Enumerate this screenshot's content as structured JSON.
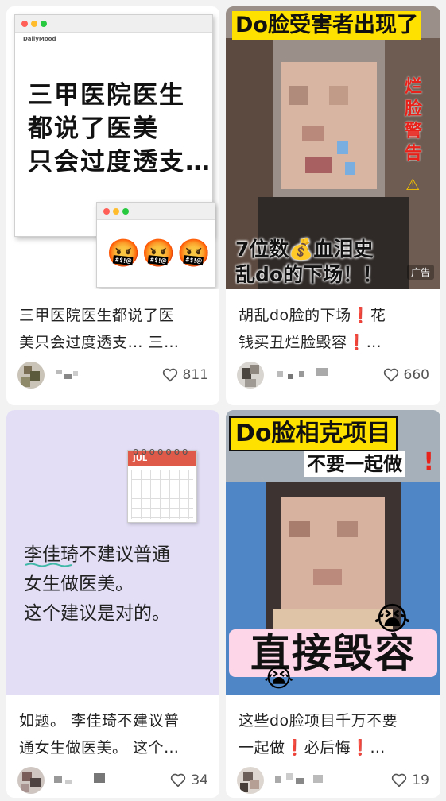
{
  "feed": {
    "cards": [
      {
        "thumb": {
          "window_address": "DailyMood",
          "big_text_lines": [
            "三甲医院医生",
            "都说了医美",
            "只会过度透支…"
          ],
          "emojis": "🤬🤬🤬"
        },
        "title_line1": "三甲医院医生都说了医",
        "title_line2": "美只会过度透支… 三…",
        "likes": "811"
      },
      {
        "thumb": {
          "headline": "Do脸受害者出现了",
          "side_text": "烂脸警告",
          "warning_icon": "⚠",
          "bottom_line1": "7位数💰血泪史",
          "bottom_line2": "乱do的下场！！",
          "ad_label": "广告"
        },
        "title_line1": "胡乱do脸的下场❗花",
        "title_line2": "钱买丑烂脸毁容❗…",
        "likes": "660"
      },
      {
        "thumb": {
          "calendar_month": "JUL",
          "quote_lines": [
            "李佳琦不建议普通",
            "女生做医美。",
            "这个建议是对的。"
          ]
        },
        "title_line1": "如题。 李佳琦不建议普",
        "title_line2": "通女生做医美。 这个…",
        "likes": "34"
      },
      {
        "thumb": {
          "headline": "Do脸相克项目",
          "subheadline": "不要一起做",
          "exclaim": "!",
          "big_text": "直接毁容",
          "emoji_top": "😭",
          "emoji_bottom": "😭"
        },
        "title_line1": "这些do脸项目千万不要",
        "title_line2": "一起做❗必后悔❗…",
        "likes": "19"
      }
    ]
  },
  "colors": {
    "background": "#f2f2f2",
    "card": "#ffffff",
    "highlight_yellow": "#ffe100",
    "warning_red": "#e8221a",
    "lavender": "#e3def5"
  }
}
